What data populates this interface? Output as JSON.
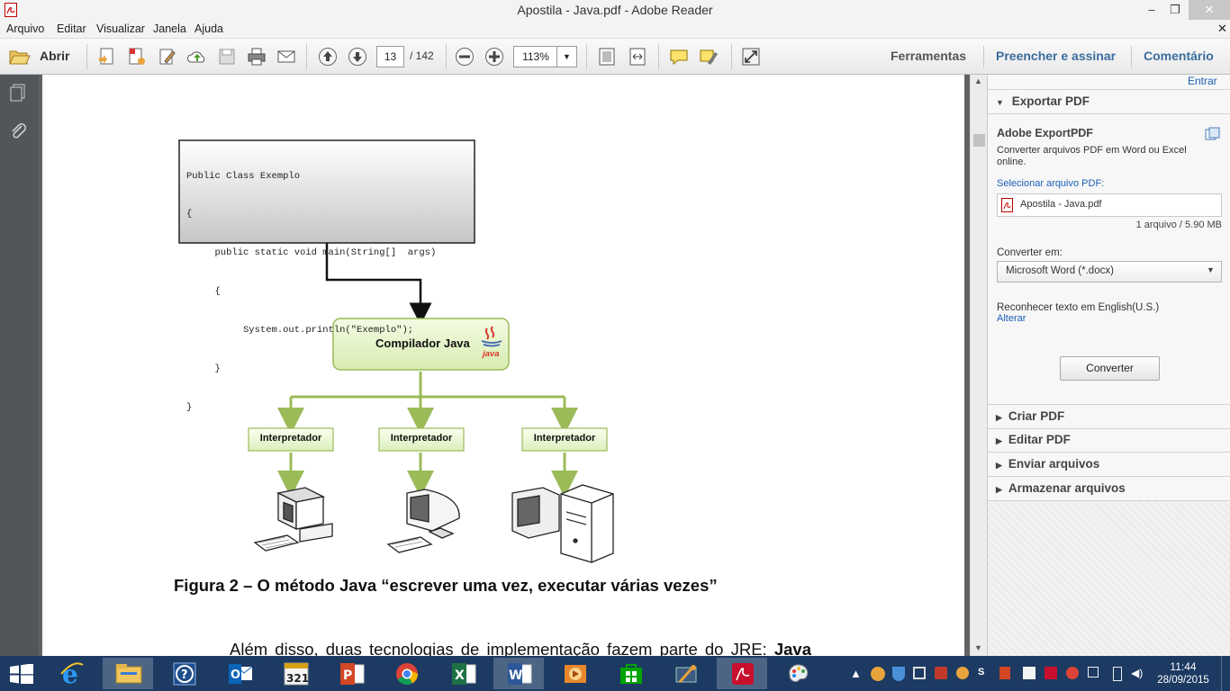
{
  "window": {
    "title": "Apostila - Java.pdf - Adobe Reader"
  },
  "menu": [
    "Arquivo",
    "Editar",
    "Visualizar",
    "Janela",
    "Ajuda"
  ],
  "toolbar": {
    "open_label": "Abrir",
    "page_current": "13",
    "page_total": "/ 142",
    "zoom": "113%",
    "tools_label": "Ferramentas",
    "fill_sign_label": "Preencher e assinar",
    "comment_label": "Comentário"
  },
  "document": {
    "code_lines": [
      "Public Class Exemplo",
      "{",
      "     public static void main(String[]  args)",
      "     {",
      "          System.out.println(\"Exemplo\");",
      "     }",
      "}"
    ],
    "compiler_label": "Compilador Java",
    "java_logo_text": "java",
    "interpreters": [
      "Interpretador",
      "Interpretador",
      "Interpretador"
    ],
    "caption": "Figura 2 – O método Java “escrever uma vez, executar várias vezes”",
    "body_text_start": "Além disso, duas tecnologias de implementação fazem parte do JRE: ",
    "body_text_bold": "Java"
  },
  "panel": {
    "signin": "Entrar",
    "export_header": "Exportar PDF",
    "service_title": "Adobe ExportPDF",
    "service_desc": "Converter arquivos PDF em Word ou Excel online.",
    "select_label": "Selecionar arquivo PDF:",
    "file_name": "Apostila - Java.pdf",
    "file_info": "1 arquivo / 5.90 MB",
    "convert_to_label": "Converter em:",
    "format_selected": "Microsoft Word (*.docx)",
    "ocr_text": "Reconhecer texto em English(U.S.)",
    "change_link": "Alterar",
    "convert_button": "Converter",
    "sections": [
      "Criar PDF",
      "Editar PDF",
      "Enviar arquivos",
      "Armazenar arquivos"
    ]
  },
  "taskbar": {
    "time": "11:44",
    "date": "28/09/2015",
    "apps": [
      "internet-explorer",
      "file-explorer",
      "help",
      "outlook",
      "calendar-321",
      "powerpoint",
      "chrome",
      "excel",
      "word",
      "media",
      "store",
      "tools",
      "adobe-reader",
      "paint"
    ]
  },
  "colors": {
    "accent_blue": "#1a5fb4",
    "taskbar": "#1c3a62",
    "pdf_red": "#c8102e",
    "diagram_green": "#9bbb59"
  }
}
